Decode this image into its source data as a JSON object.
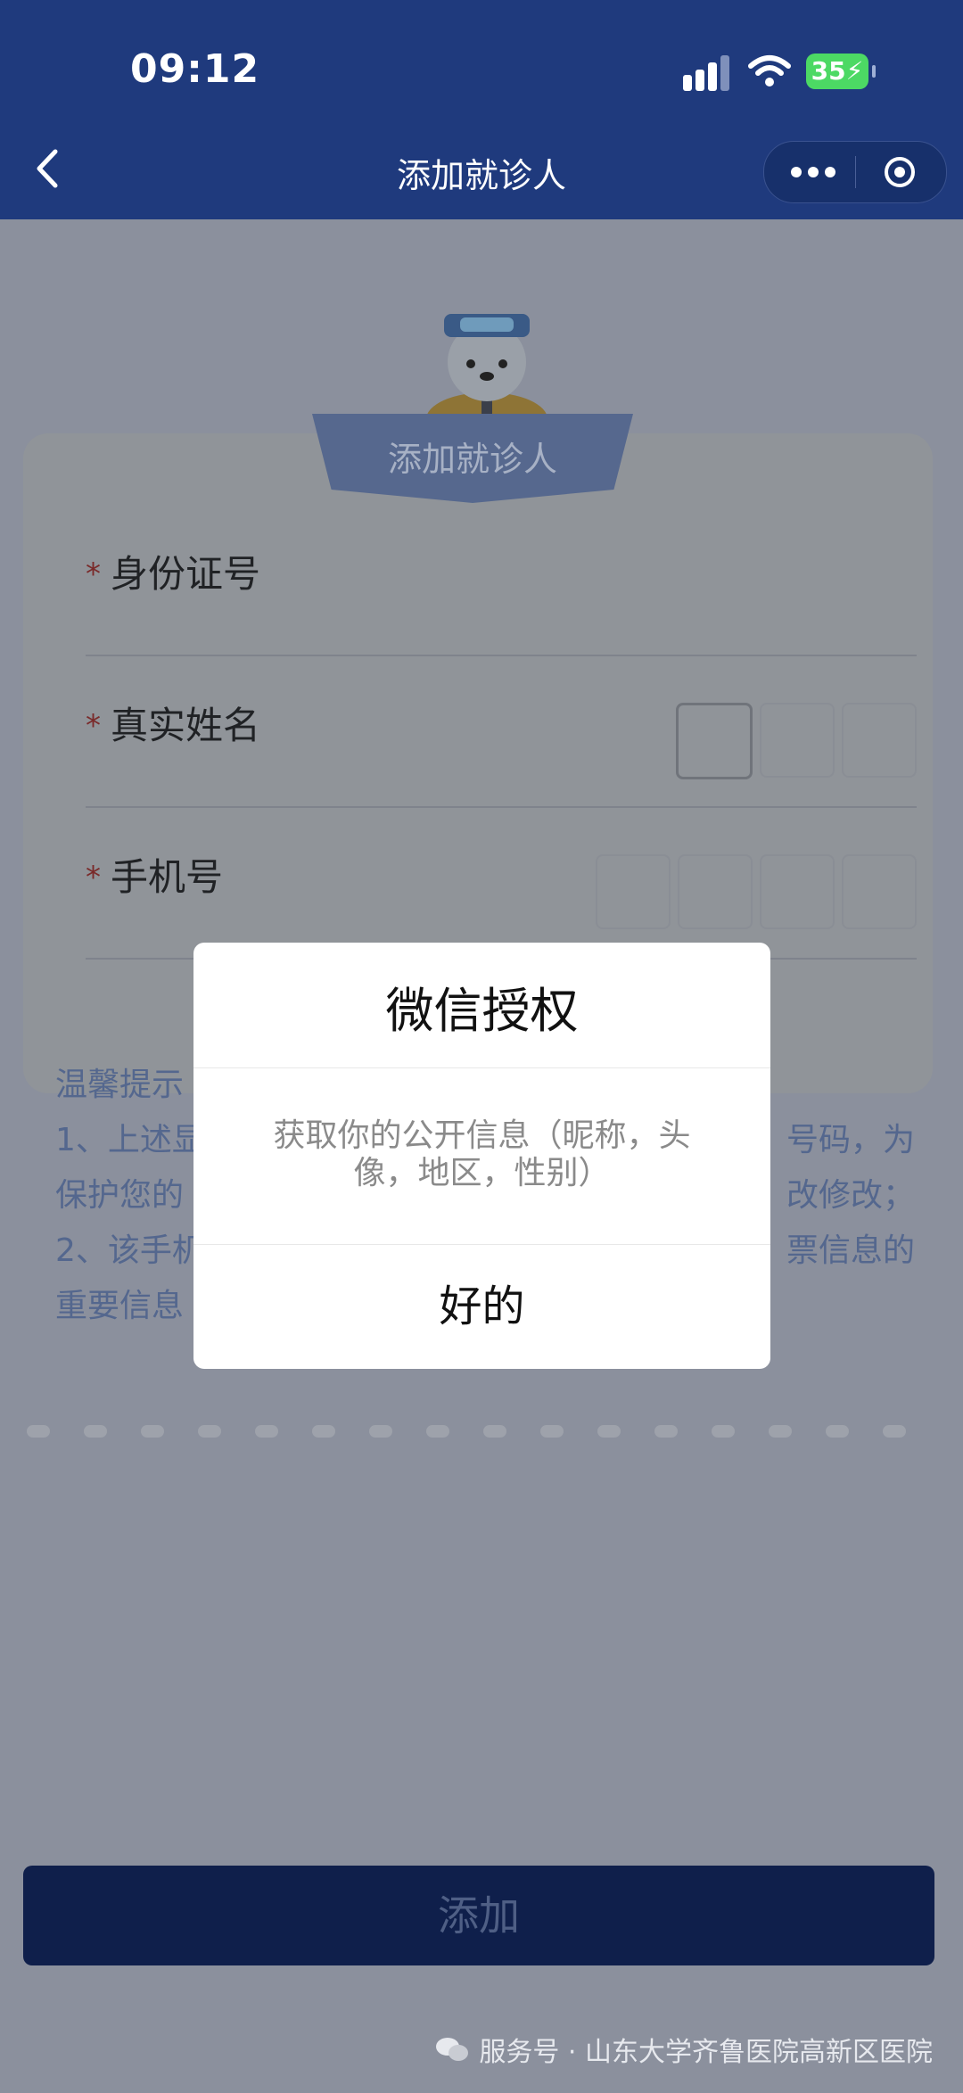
{
  "status_bar": {
    "time": "09:12",
    "battery": "35"
  },
  "nav": {
    "title": "添加就诊人"
  },
  "card": {
    "tab_label": "添加就诊人"
  },
  "form": {
    "id_label": "身份证号",
    "name_label": "真实姓名",
    "phone_label": "手机号",
    "required_mark": "*"
  },
  "tips": {
    "title": "温馨提示",
    "line1_left": "1、上述显",
    "line1_right": "号码，为",
    "line2_left": "保护您的",
    "line2_right": "改修改；",
    "line3_left": "2、该手机",
    "line3_right": "票信息的",
    "line4_left": "重要信息"
  },
  "dialog": {
    "title": "微信授权",
    "body": "获取你的公开信息（昵称，头像，地区，性别）",
    "ok_label": "好的"
  },
  "add_button": {
    "label": "添加"
  },
  "footer": {
    "credit": "服务号 · 山东大学齐鲁医院高新区医院"
  },
  "colors": {
    "nav_bg": "#1f3a7d",
    "battery": "#4cd964",
    "button_bg": "#0f1f4b"
  }
}
